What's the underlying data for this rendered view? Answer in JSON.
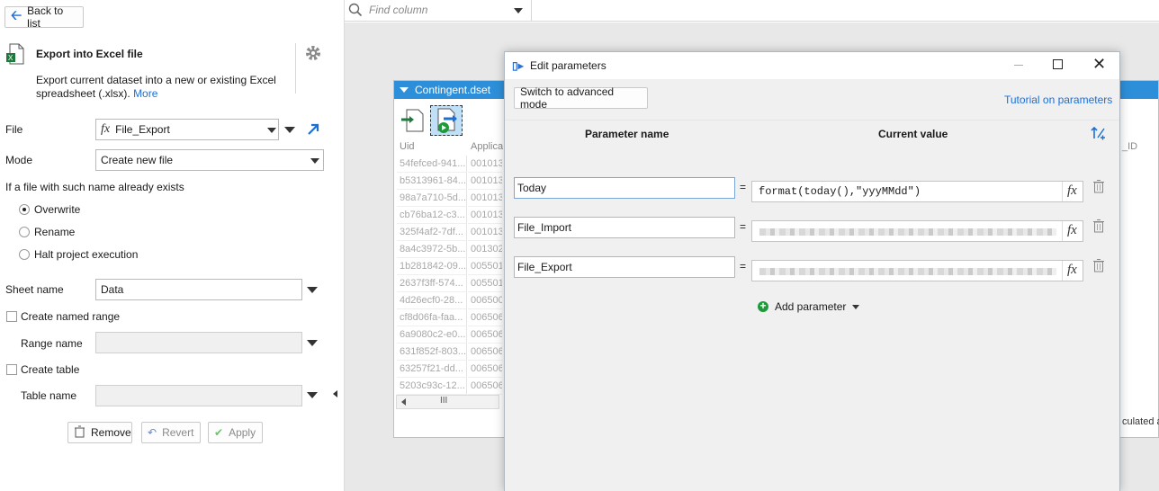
{
  "left_panel": {
    "back_label": "Back to list",
    "title": "Export into Excel file",
    "description": "Export current dataset into a new or existing Excel spreadsheet (.xlsx).",
    "more_link": "More",
    "file_label": "File",
    "file_value": "File_Export",
    "mode_label": "Mode",
    "mode_value": "Create new file",
    "exists_label": "If a file with such name already exists",
    "options": [
      "Overwrite",
      "Rename",
      "Halt project execution"
    ],
    "selected_option": "Overwrite",
    "sheet_label": "Sheet name",
    "sheet_value": "Data",
    "named_range_label": "Create named range",
    "range_name_label": "Range name",
    "create_table_label": "Create table",
    "table_name_label": "Table name",
    "remove_label": "Remove",
    "revert_label": "Revert",
    "apply_label": "Apply"
  },
  "toolbar": {
    "find_placeholder": "Find column"
  },
  "dataset": {
    "title": "Contingent.dset",
    "headers": [
      "Uid",
      "Applica"
    ],
    "rows": [
      [
        "54fefced-941...",
        "001013"
      ],
      [
        "b5313961-84...",
        "001013"
      ],
      [
        "98a7a710-5d...",
        "001013"
      ],
      [
        "cb76ba12-c3...",
        "001013"
      ],
      [
        "325f4af2-7df...",
        "001013"
      ],
      [
        "8a4c3972-5b...",
        "001302"
      ],
      [
        "1b281842-09...",
        "005501"
      ],
      [
        "2637f3ff-574...",
        "005501"
      ],
      [
        "4d26ecf0-28...",
        "006500"
      ],
      [
        "cf8d06fa-faa...",
        "006506"
      ],
      [
        "6a9080c2-e0...",
        "006506"
      ],
      [
        "631f852f-803...",
        "006506"
      ],
      [
        "63257f21-dd...",
        "006506"
      ],
      [
        "5203c93c-12...",
        "006506"
      ]
    ],
    "right_header": "_ID",
    "right_footer": "culated a"
  },
  "dialog": {
    "title": "Edit parameters",
    "advanced_button": "Switch to advanced mode",
    "tutorial_link": "Tutorial on parameters",
    "col_name": "Parameter name",
    "col_value": "Current value",
    "params": [
      {
        "name": "Today",
        "value": "format(today(),\"yyyMMdd\")",
        "blurred": false
      },
      {
        "name": "File_Import",
        "value": "",
        "blurred": true
      },
      {
        "name": "File_Export",
        "value": "",
        "blurred": true
      }
    ],
    "add_label": "Add parameter"
  }
}
